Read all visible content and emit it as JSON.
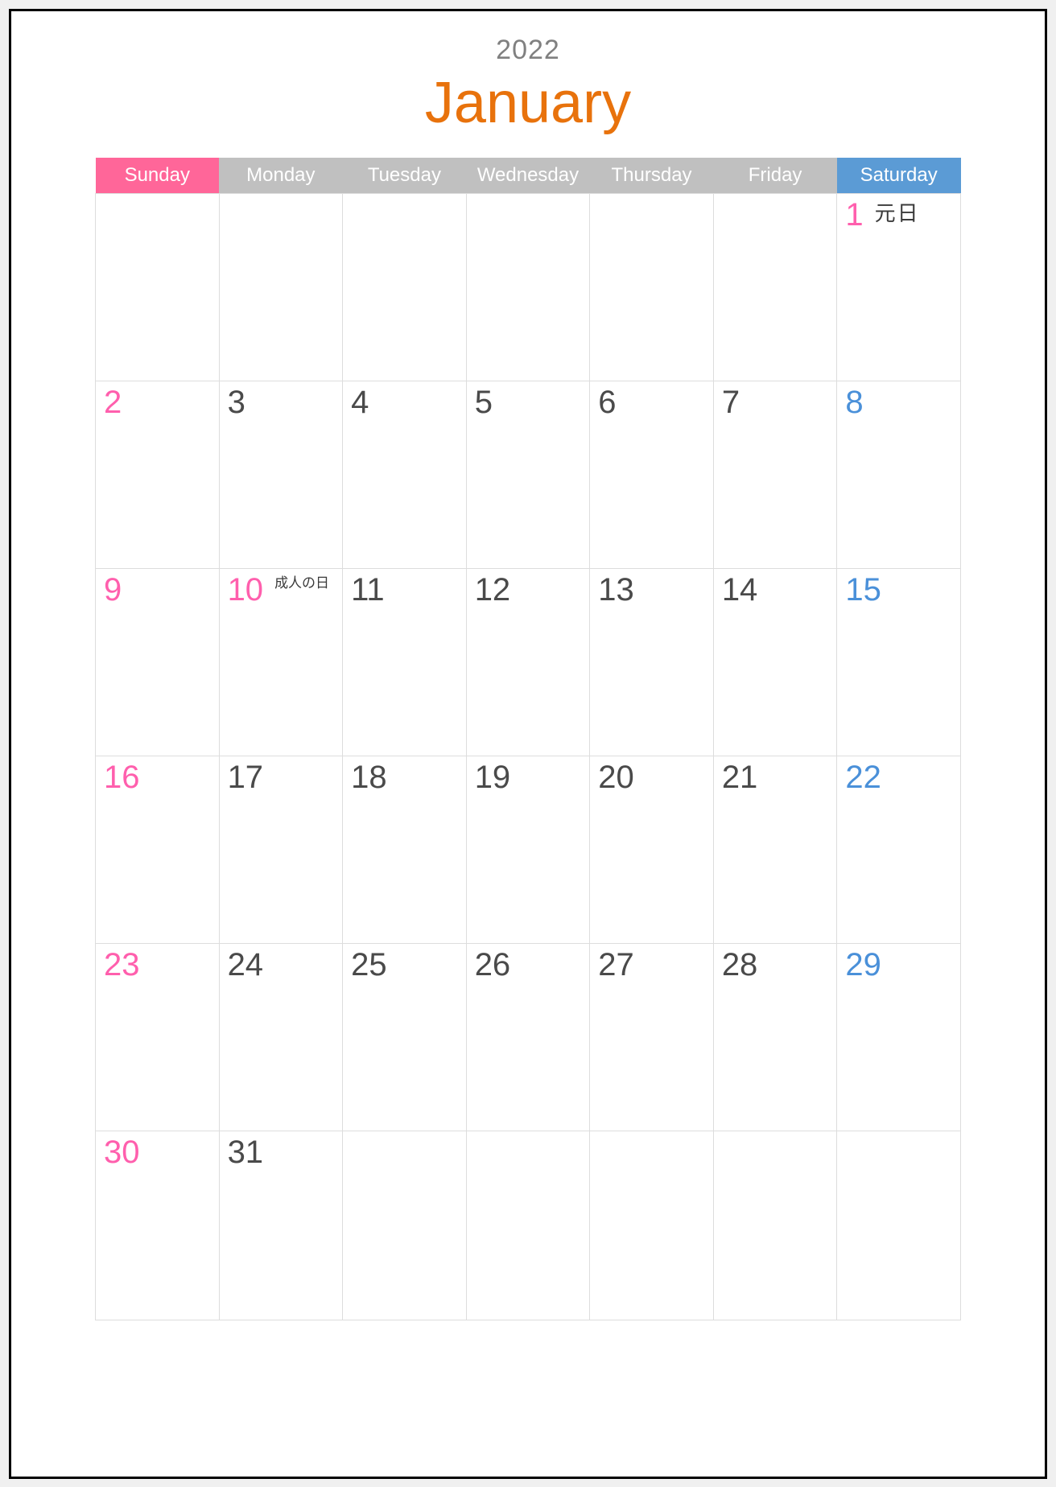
{
  "document": {
    "type": "monthly-calendar",
    "year": "2022",
    "month_name": "January",
    "locale_notes": "Japanese holidays annotated"
  },
  "colors": {
    "year_text": "#808080",
    "month_text": "#E8720C",
    "sunday_header_bg": "#FF6699",
    "weekday_header_bg": "#C0C0C0",
    "saturday_header_bg": "#5B9BD5",
    "header_text": "#FFFFFF",
    "sunday_number": "#FF5FAD",
    "saturday_number": "#4A90D9",
    "weekday_number": "#4A4A4A",
    "holiday_number": "#FF5FAD",
    "grid_line": "#DDDDDD",
    "page_border": "#000000",
    "page_bg": "#FFFFFF",
    "outer_bg": "#F0F0F0"
  },
  "header": {
    "days": [
      {
        "label": "Sunday",
        "kind": "sun"
      },
      {
        "label": "Monday",
        "kind": "week"
      },
      {
        "label": "Tuesday",
        "kind": "week"
      },
      {
        "label": "Wednesday",
        "kind": "week"
      },
      {
        "label": "Thursday",
        "kind": "week"
      },
      {
        "label": "Friday",
        "kind": "week"
      },
      {
        "label": "Saturday",
        "kind": "sat"
      }
    ]
  },
  "weeks": [
    [
      {
        "day": "",
        "holiday": ""
      },
      {
        "day": "",
        "holiday": ""
      },
      {
        "day": "",
        "holiday": ""
      },
      {
        "day": "",
        "holiday": ""
      },
      {
        "day": "",
        "holiday": ""
      },
      {
        "day": "",
        "holiday": ""
      },
      {
        "day": "1",
        "holiday": "元日"
      }
    ],
    [
      {
        "day": "2",
        "holiday": ""
      },
      {
        "day": "3",
        "holiday": ""
      },
      {
        "day": "4",
        "holiday": ""
      },
      {
        "day": "5",
        "holiday": ""
      },
      {
        "day": "6",
        "holiday": ""
      },
      {
        "day": "7",
        "holiday": ""
      },
      {
        "day": "8",
        "holiday": ""
      }
    ],
    [
      {
        "day": "9",
        "holiday": ""
      },
      {
        "day": "10",
        "holiday": "成人の日"
      },
      {
        "day": "11",
        "holiday": ""
      },
      {
        "day": "12",
        "holiday": ""
      },
      {
        "day": "13",
        "holiday": ""
      },
      {
        "day": "14",
        "holiday": ""
      },
      {
        "day": "15",
        "holiday": ""
      }
    ],
    [
      {
        "day": "16",
        "holiday": ""
      },
      {
        "day": "17",
        "holiday": ""
      },
      {
        "day": "18",
        "holiday": ""
      },
      {
        "day": "19",
        "holiday": ""
      },
      {
        "day": "20",
        "holiday": ""
      },
      {
        "day": "21",
        "holiday": ""
      },
      {
        "day": "22",
        "holiday": ""
      }
    ],
    [
      {
        "day": "23",
        "holiday": ""
      },
      {
        "day": "24",
        "holiday": ""
      },
      {
        "day": "25",
        "holiday": ""
      },
      {
        "day": "26",
        "holiday": ""
      },
      {
        "day": "27",
        "holiday": ""
      },
      {
        "day": "28",
        "holiday": ""
      },
      {
        "day": "29",
        "holiday": ""
      }
    ],
    [
      {
        "day": "30",
        "holiday": ""
      },
      {
        "day": "31",
        "holiday": ""
      },
      {
        "day": "",
        "holiday": ""
      },
      {
        "day": "",
        "holiday": ""
      },
      {
        "day": "",
        "holiday": ""
      },
      {
        "day": "",
        "holiday": ""
      },
      {
        "day": "",
        "holiday": ""
      }
    ]
  ]
}
